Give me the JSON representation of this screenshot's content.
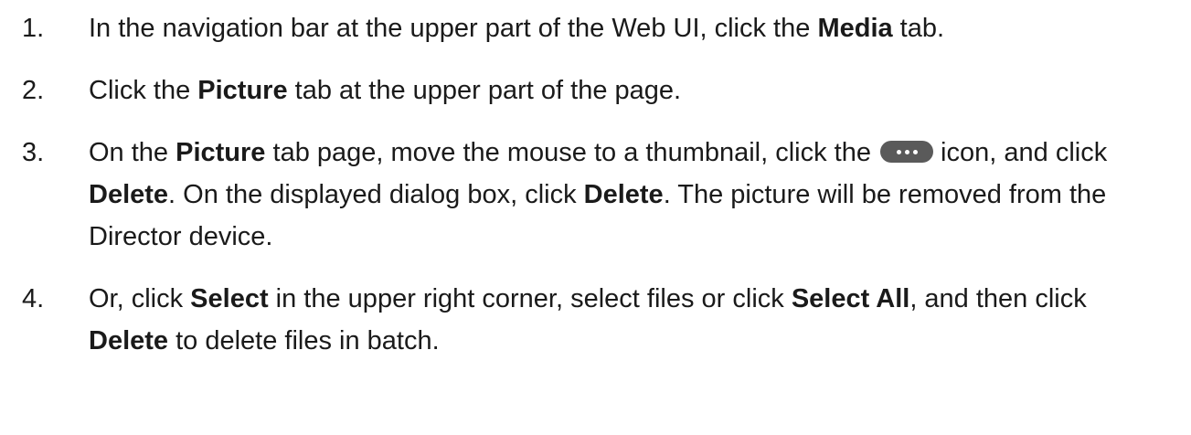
{
  "steps": [
    {
      "number": "1.",
      "t0": "In the navigation bar at the upper part of the Web UI, click the ",
      "b0": "Media",
      "t1": " tab."
    },
    {
      "number": "2.",
      "t0": "Click the ",
      "b0": "Picture",
      "t1": " tab at the upper part of the page."
    },
    {
      "number": "3.",
      "t0": "On the ",
      "b0": "Picture",
      "t1": " tab page, move the mouse to a thumbnail, click the",
      "icon": "more-options-icon",
      "t2": " icon, and click ",
      "b1": "Delete",
      "t3": ". On the displayed dialog box, click ",
      "b2": "Delete",
      "t4": ". The picture will be removed from the Director device."
    },
    {
      "number": "4.",
      "t0": "Or, click ",
      "b0": "Select",
      "t1": " in the upper right corner, select files or click ",
      "b1": "Select All",
      "t2": ", and then click ",
      "b2": "Delete",
      "t3": " to delete files in batch."
    }
  ],
  "colors": {
    "text": "#1a1a1a",
    "icon_background": "#5a5a5a",
    "icon_dots": "#ffffff"
  }
}
